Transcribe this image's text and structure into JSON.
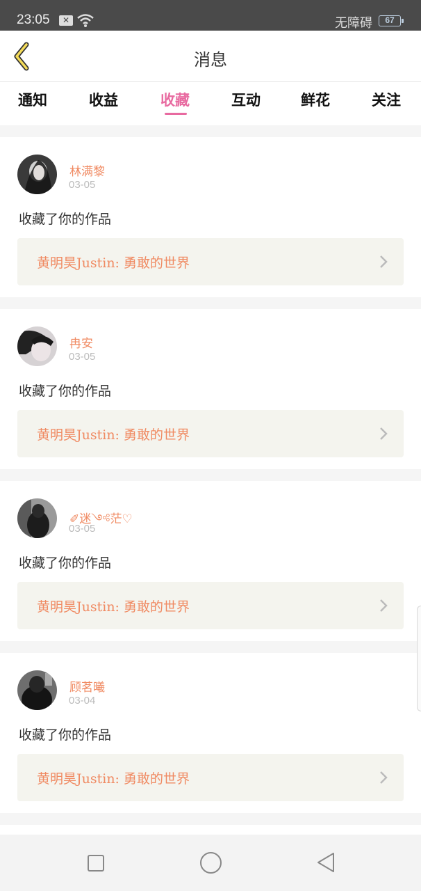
{
  "status": {
    "time": "23:05",
    "accessibility": "无障碍",
    "battery": "67"
  },
  "header": {
    "title": "消息"
  },
  "tabs": [
    {
      "label": "通知"
    },
    {
      "label": "收益"
    },
    {
      "label": "收藏"
    },
    {
      "label": "互动"
    },
    {
      "label": "鲜花"
    },
    {
      "label": "关注"
    }
  ],
  "active_tab": "收藏",
  "messages": [
    {
      "user": "林满黎",
      "date": "03-05",
      "action": "收藏了你的作品",
      "work": "黄明昊Justin: 勇敢的世界"
    },
    {
      "user": "冉安",
      "date": "03-05",
      "action": "收藏了你的作品",
      "work": "黄明昊Justin: 勇敢的世界"
    },
    {
      "user": "✐迷༺茫♡",
      "date": "03-05",
      "action": "收藏了你的作品",
      "work": "黄明昊Justin: 勇敢的世界"
    },
    {
      "user": "顾茗曦",
      "date": "03-04",
      "action": "收藏了你的作品",
      "work": "黄明昊Justin: 勇敢的世界"
    }
  ],
  "colors": {
    "accent": "#e86aa0",
    "name": "#f08a62",
    "work_bg": "#f4f4ee"
  }
}
